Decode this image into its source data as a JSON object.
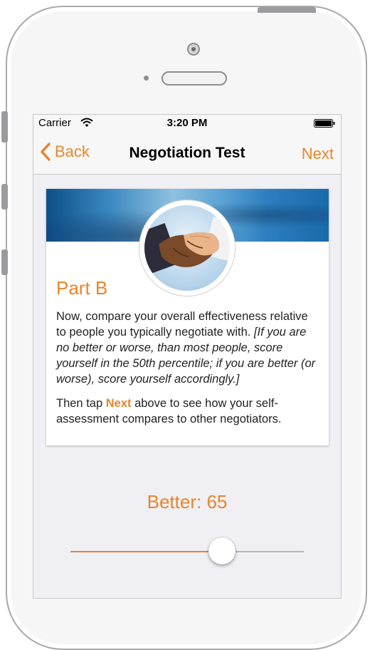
{
  "status_bar": {
    "carrier": "Carrier",
    "time": "3:20 PM",
    "icons": [
      "wifi-icon",
      "battery-icon"
    ]
  },
  "nav_bar": {
    "back_label": "Back",
    "title": "Negotiation Test",
    "next_label": "Next"
  },
  "card": {
    "image": "handshake-photo",
    "part_title": "Part B",
    "para1_normal": "Now, compare your overall effectiveness relative to people you typically negotiate with. ",
    "para1_italic": "[If you are no better or worse, than most people, score yourself in the 50th percentile; if you are better (or worse), score yourself accordingly.]",
    "para2_before": "Then tap ",
    "para2_highlight": "Next",
    "para2_after": " above to see how your self-assessment compares to other negotiators."
  },
  "score": {
    "label": "Better: 65",
    "value": 65,
    "min": 0,
    "max": 100
  },
  "colors": {
    "accent": "#e8852b",
    "background": "#efeff4",
    "bar": "#f7f7f7"
  }
}
